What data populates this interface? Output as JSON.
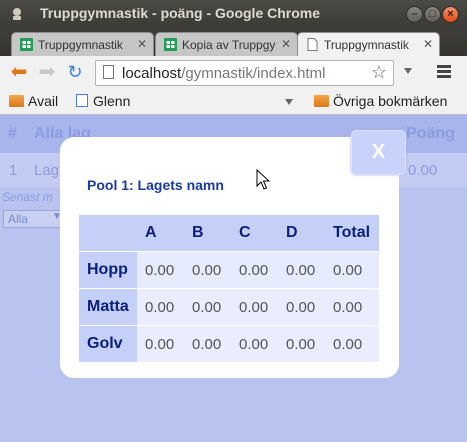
{
  "window": {
    "title": "Truppgymnastik - poäng - Google Chrome"
  },
  "tabs": [
    {
      "label": "Truppgymnastik",
      "icon": "sheets-icon",
      "active": false
    },
    {
      "label": "Kopia av Truppgy",
      "icon": "sheets-icon",
      "active": false
    },
    {
      "label": "Truppgymnastik",
      "icon": "page-icon",
      "active": true
    }
  ],
  "toolbar": {
    "url_host": "localhost",
    "url_path": "/gymnastik/index.html"
  },
  "bookmarks": {
    "items": [
      {
        "label": "Avail",
        "icon": "folder-icon"
      },
      {
        "label": "Glenn",
        "icon": "page-icon"
      }
    ],
    "other": "Övriga bokmärken"
  },
  "background": {
    "col_hash": "#",
    "col_team": "Alla lag",
    "col_points": "Poäng",
    "row_num": "1",
    "row_team": "Lag",
    "row_points": "0.00",
    "senast": "Senast m",
    "select_value": "Alla"
  },
  "modal": {
    "close_label": "X",
    "title": "Pool 1: Lagets namn",
    "columns": [
      "",
      "A",
      "B",
      "C",
      "D",
      "Total"
    ],
    "rows": [
      {
        "name": "Hopp",
        "values": [
          "0.00",
          "0.00",
          "0.00",
          "0.00",
          "0.00"
        ]
      },
      {
        "name": "Matta",
        "values": [
          "0.00",
          "0.00",
          "0.00",
          "0.00",
          "0.00"
        ]
      },
      {
        "name": "Golv",
        "values": [
          "0.00",
          "0.00",
          "0.00",
          "0.00",
          "0.00"
        ]
      }
    ]
  }
}
